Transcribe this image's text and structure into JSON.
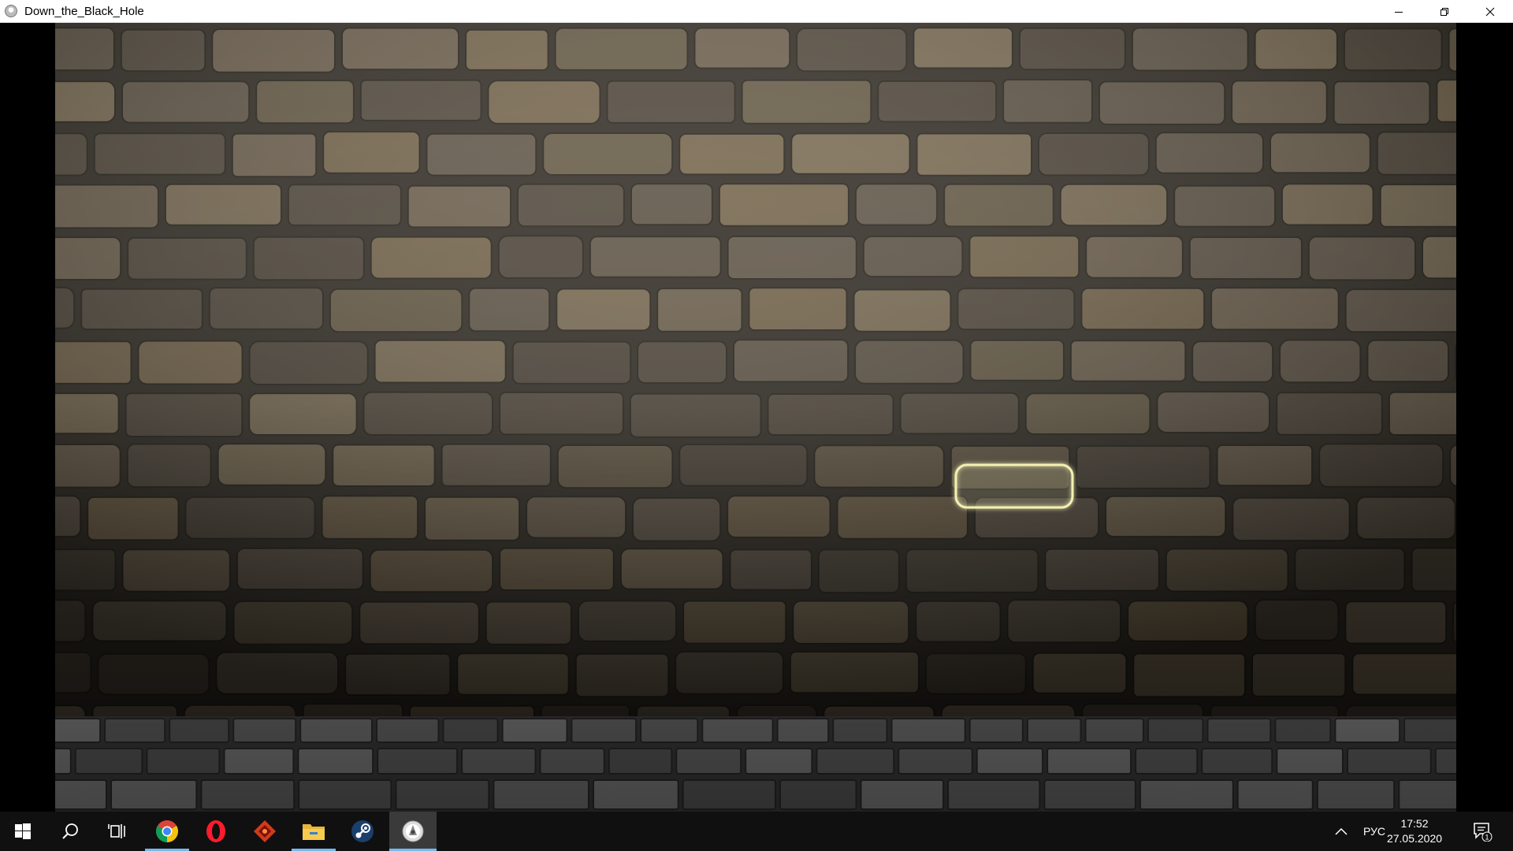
{
  "window": {
    "title": "Down_the_Black_Hole",
    "controls": [
      "minimize",
      "restore",
      "close"
    ]
  },
  "scene": {
    "background": "stone-brick-wall",
    "floor": "cobblestone-floor",
    "hotspot": {
      "name": "glowing-brick",
      "highlight_color": "#f4f0b0"
    }
  },
  "taskbar": {
    "start_icon": "windows-logo-icon",
    "search_icon": "search-icon",
    "task_view_icon": "task-view-icon",
    "pinned": [
      {
        "name": "chrome-icon",
        "running": true
      },
      {
        "name": "opera-icon",
        "running": false
      },
      {
        "name": "red-game-launcher-icon",
        "running": false
      },
      {
        "name": "file-explorer-icon",
        "running": true
      },
      {
        "name": "steam-icon",
        "running": false
      },
      {
        "name": "game-app-icon",
        "running": true,
        "active": true
      }
    ],
    "tray": {
      "show_hidden_icon": "chevron-up-icon",
      "language": "РУС",
      "time": "17:52",
      "date": "27.05.2020",
      "notification_count": "1"
    },
    "accent": "#76b9ed"
  }
}
